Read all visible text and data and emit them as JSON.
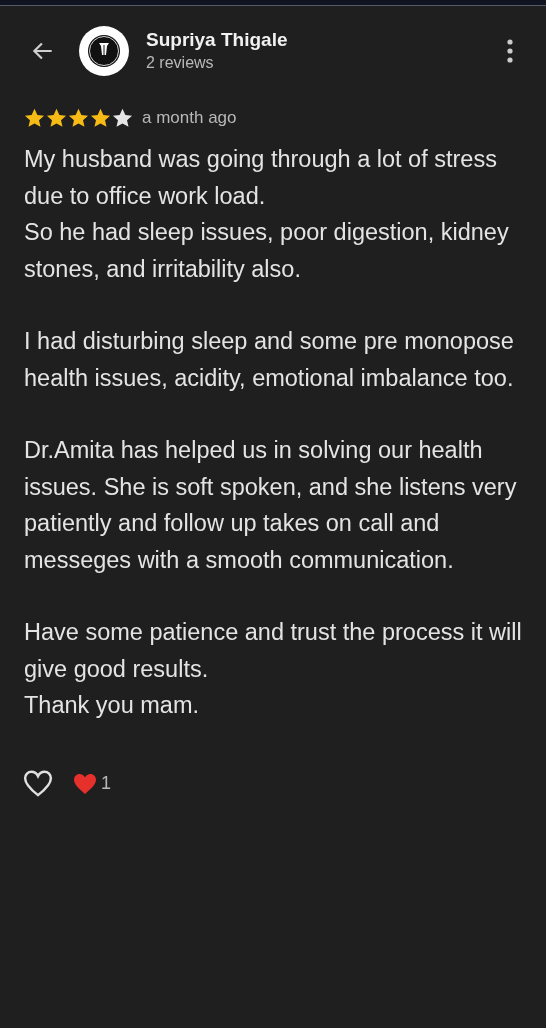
{
  "header": {
    "name": "Supriya Thigale",
    "subtitle": "2 reviews"
  },
  "review": {
    "stars": 4,
    "time": "a month ago",
    "paragraphs": [
      [
        "My husband was going through a lot of stress due to office work load.",
        "So he had sleep issues, poor digestion, kidney stones, and irritability also."
      ],
      [
        "I had disturbing sleep and some pre monopose health issues, acidity, emotional imbalance too."
      ],
      [
        "Dr.Amita has helped us in solving our health issues. She is soft spoken, and she listens very patiently and follow up takes on call and messeges with a smooth communication."
      ],
      [
        "Have some patience and trust the process it will give good results.",
        "Thank you mam."
      ]
    ]
  },
  "reactions": {
    "liked": false,
    "heart_count": "1"
  }
}
